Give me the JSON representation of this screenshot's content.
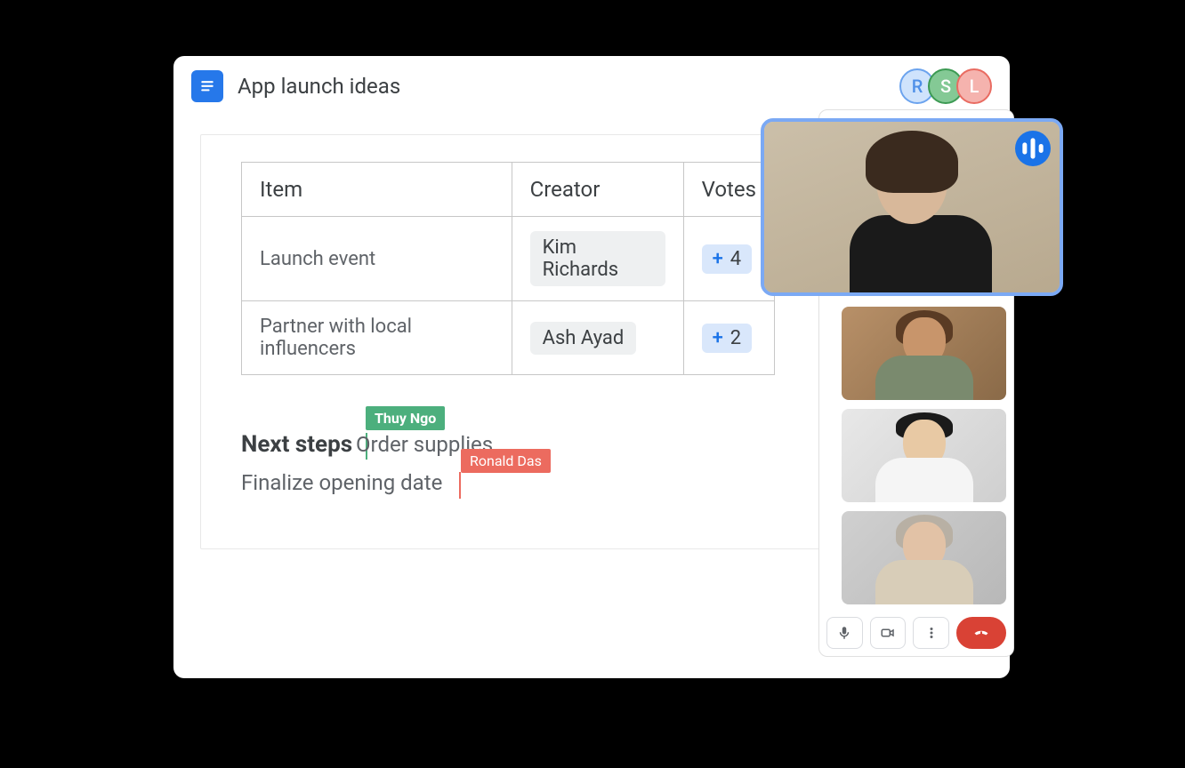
{
  "doc": {
    "title": "App launch ideas"
  },
  "collaborators": [
    {
      "initial": "R",
      "color_class": "avatar-r"
    },
    {
      "initial": "S",
      "color_class": "avatar-s"
    },
    {
      "initial": "L",
      "color_class": "avatar-l"
    }
  ],
  "table": {
    "headers": {
      "item": "Item",
      "creator": "Creator",
      "votes": "Votes"
    },
    "rows": [
      {
        "item": "Launch event",
        "creator": "Kim Richards",
        "votes": "4"
      },
      {
        "item": "Partner with local influencers",
        "creator": "Ash Ayad",
        "votes": "2"
      }
    ]
  },
  "next_steps": {
    "heading": "Next steps",
    "items": [
      "Order supplies",
      "Finalize opening date"
    ]
  },
  "cursors": {
    "green": {
      "name": "Thuy Ngo"
    },
    "red": {
      "name": "Ronald Das"
    }
  },
  "vote_plus": "+",
  "video": {
    "participant_count": 4
  }
}
